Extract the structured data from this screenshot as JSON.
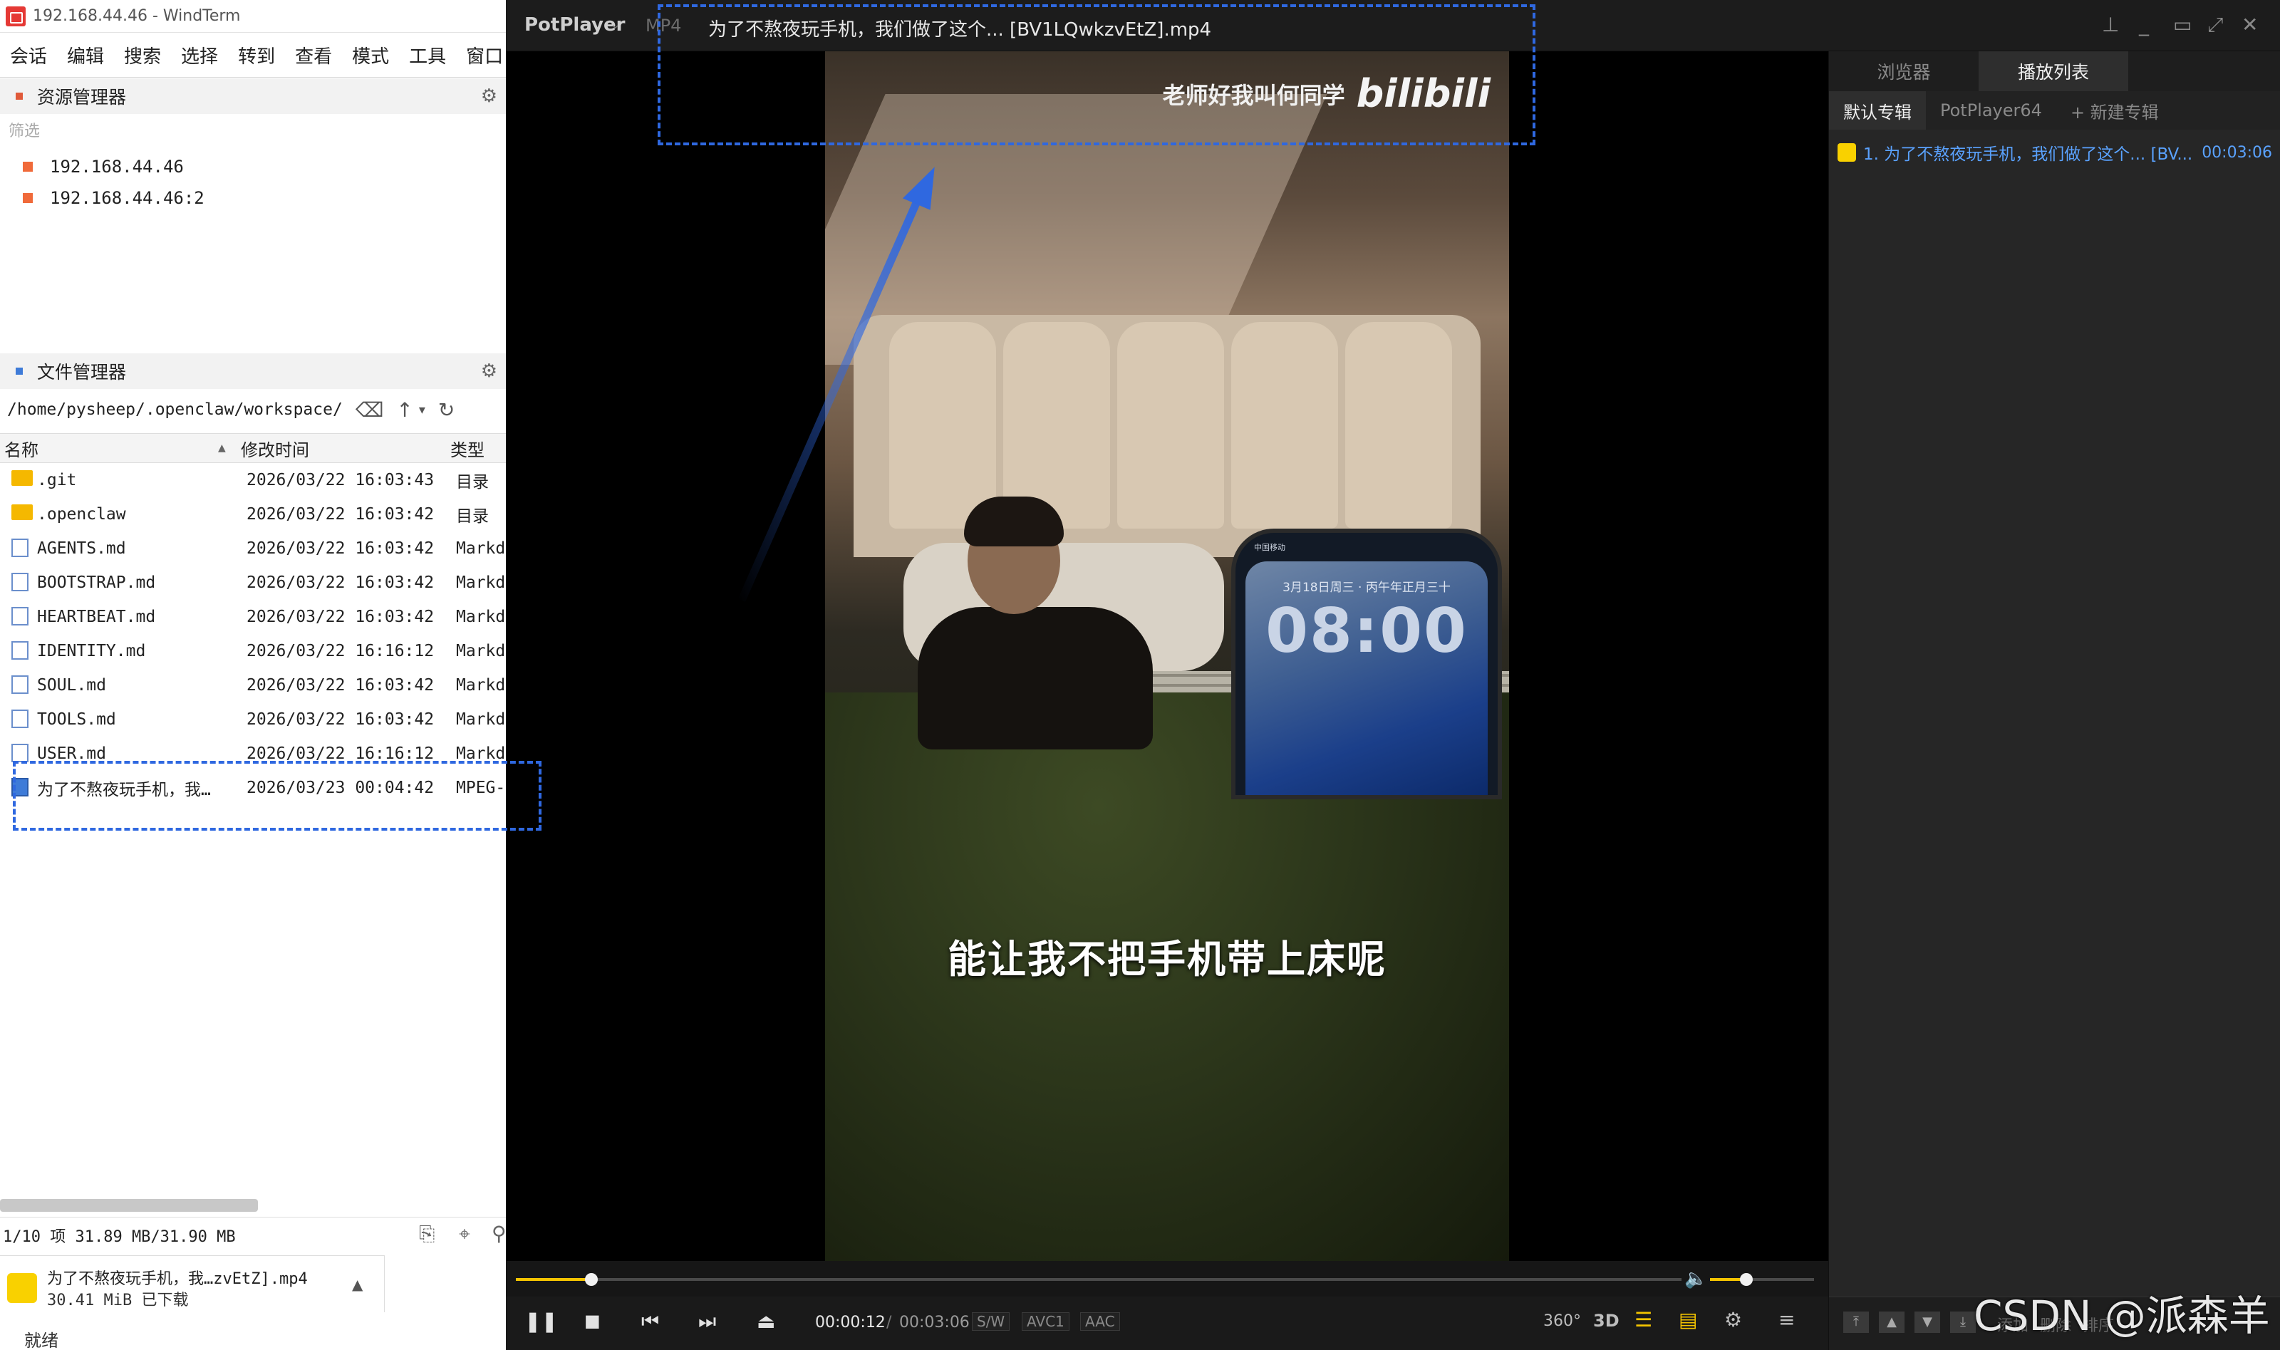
{
  "windterm": {
    "title": "192.168.44.46 - WindTerm",
    "menus": [
      "会话",
      "编辑",
      "搜索",
      "选择",
      "转到",
      "查看",
      "模式",
      "工具",
      "窗口"
    ],
    "resource_manager": {
      "title": "资源管理器",
      "filter_placeholder": "筛选",
      "items": [
        "192.168.44.46",
        "192.168.44.46:2"
      ]
    },
    "file_manager": {
      "title": "文件管理器",
      "path": "/home/pysheep/.openclaw/workspace/",
      "columns": {
        "name": "名称",
        "modified": "修改时间",
        "type": "类型"
      },
      "rows": [
        {
          "name": ".git",
          "date": "2026/03/22 16:03:43",
          "type": "目录",
          "icon": "folder"
        },
        {
          "name": ".openclaw",
          "date": "2026/03/22 16:03:42",
          "type": "目录",
          "icon": "folder"
        },
        {
          "name": "AGENTS.md",
          "date": "2026/03/22 16:03:42",
          "type": "Markd",
          "icon": "doc"
        },
        {
          "name": "BOOTSTRAP.md",
          "date": "2026/03/22 16:03:42",
          "type": "Markd",
          "icon": "doc"
        },
        {
          "name": "HEARTBEAT.md",
          "date": "2026/03/22 16:03:42",
          "type": "Markd",
          "icon": "doc"
        },
        {
          "name": "IDENTITY.md",
          "date": "2026/03/22 16:16:12",
          "type": "Markd",
          "icon": "doc"
        },
        {
          "name": "SOUL.md",
          "date": "2026/03/22 16:03:42",
          "type": "Markd",
          "icon": "doc"
        },
        {
          "name": "TOOLS.md",
          "date": "2026/03/22 16:03:42",
          "type": "Markd",
          "icon": "doc"
        },
        {
          "name": "USER.md",
          "date": "2026/03/22 16:16:12",
          "type": "Markd",
          "icon": "doc"
        },
        {
          "name": "为了不熬夜玩手机，我…",
          "date": "2026/03/23 00:04:42",
          "type": "MPEG-",
          "icon": "video"
        }
      ],
      "status": "1/10 项 31.89 MB/31.90 MB"
    },
    "download": {
      "name": "为了不熬夜玩手机，我…zvEtZ].mp4",
      "size": "30.41 MiB 已下载"
    },
    "ready": "就绪"
  },
  "potplayer": {
    "brand": "PotPlayer",
    "format": "MP4",
    "filename": "为了不熬夜玩手机，我们做了这个... [BV1LQwkzvEtZ].mp4",
    "video": {
      "watermark_text": "老师好我叫何同学",
      "watermark_logo": "bilibili",
      "subtitle": "能让我不把手机带上床呢",
      "phone_date": "3月18日周三 · 丙午年正月三十",
      "phone_time": "08:00",
      "phone_status": "中国移动"
    },
    "playback": {
      "current": "00:00:12",
      "separator": "/",
      "total": "00:03:06",
      "progress": 0.065,
      "volume": 0.35,
      "codecs": [
        "S/W",
        "AVC1",
        "AAC"
      ],
      "right_icons": [
        "360°",
        "3D"
      ]
    },
    "playlist": {
      "tabs": [
        "浏览器",
        "播放列表"
      ],
      "subtabs": [
        "默认专辑",
        "PotPlayer64",
        "+ 新建专辑"
      ],
      "items": [
        {
          "title": "1. 为了不熬夜玩手机，我们做了这个... [BV...",
          "duration": "00:03:06"
        }
      ],
      "footer_labels": [
        "添加",
        "删除",
        "排序"
      ]
    }
  },
  "overlay_text": "CSDN @派森羊",
  "colors": {
    "annotation": "#2f68e0",
    "accent": "#f4c400",
    "link": "#5aa2ff"
  }
}
